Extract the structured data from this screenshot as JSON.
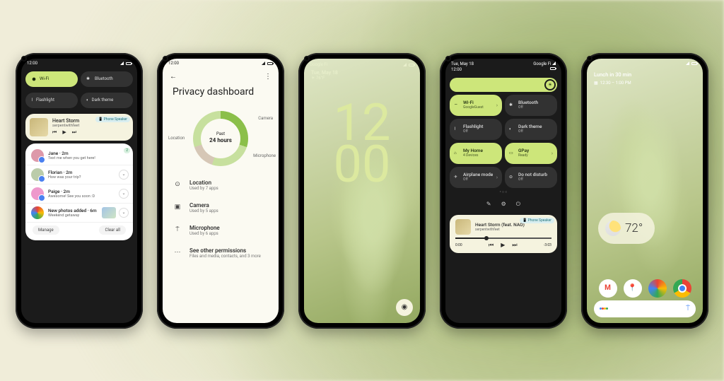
{
  "colors": {
    "accent": "#cde67a",
    "bg_dark": "#1b1b1b",
    "bg_light": "#fbfaf2",
    "tile_on": "#cde67a",
    "tile_off": "#323232"
  },
  "phone1": {
    "time": "12:00",
    "qs": [
      {
        "label": "Wi-Fi",
        "on": true
      },
      {
        "label": "Bluetooth",
        "on": false
      },
      {
        "label": "Flashlight",
        "on": false
      },
      {
        "label": "Dark theme",
        "on": false
      }
    ],
    "media": {
      "title": "Heart Storm",
      "artist": "serpentwithfeet",
      "output": "Phone Speaker"
    },
    "notifications": [
      {
        "name": "Jane",
        "time": "2m",
        "text": "Text me when you get here!",
        "badge": "2"
      },
      {
        "name": "Florian",
        "time": "2m",
        "text": "How was your trip?"
      },
      {
        "name": "Paige",
        "time": "2m",
        "text": "Awesome! See you soon :D"
      },
      {
        "name": "New photos added",
        "time": "6m",
        "text": "Weekend getaway",
        "thumb": true
      }
    ],
    "footer": {
      "manage": "Manage",
      "clear": "Clear all"
    }
  },
  "phone2": {
    "time": "12:00",
    "title": "Privacy dashboard",
    "donut": {
      "center_top": "Past",
      "center_bottom": "24 hours",
      "labels": {
        "camera": "Camera",
        "microphone": "Microphone",
        "location": "Location"
      }
    },
    "items": [
      {
        "icon": "location",
        "title": "Location",
        "sub": "Used by 7 apps"
      },
      {
        "icon": "camera",
        "title": "Camera",
        "sub": "Used by 5 apps"
      },
      {
        "icon": "mic",
        "title": "Microphone",
        "sub": "Used by 6 apps"
      },
      {
        "icon": "more",
        "title": "See other permissions",
        "sub": "Files and media, contacts, and 3 more"
      }
    ]
  },
  "phone3": {
    "carrier": "Google Fi",
    "date": "Tue, May 18",
    "temp": "76°F",
    "weather_icon": "sunny",
    "clock_top": "12",
    "clock_bottom": "00"
  },
  "phone4": {
    "date": "Tue, May 18",
    "carrier": "Google Fi",
    "time": "12:00",
    "tiles": [
      {
        "label": "Wi-Fi",
        "sub": "GoogleGuest",
        "on": true,
        "chev": true
      },
      {
        "label": "Bluetooth",
        "sub": "Off",
        "on": false
      },
      {
        "label": "Flashlight",
        "sub": "Off",
        "on": false
      },
      {
        "label": "Dark theme",
        "sub": "Off",
        "on": false
      },
      {
        "label": "My Home",
        "sub": "4 Devices",
        "on": true
      },
      {
        "label": "GPay",
        "sub": "Ready",
        "on": true,
        "chev": true
      },
      {
        "label": "Airplane mode",
        "sub": "Off",
        "on": false,
        "chev": true
      },
      {
        "label": "Do not disturb",
        "sub": "Off",
        "on": false
      }
    ],
    "media": {
      "title": "Heart Storm (feat. NAO)",
      "artist": "serpentwithfeet",
      "output": "Phone Speaker",
      "cur": "0:00",
      "dur": "-3:03"
    }
  },
  "phone5": {
    "glance_title": "Lunch in 30 min",
    "glance_sub": "12:30 – 1:00 PM",
    "temp": "72°",
    "dock": [
      "Gmail",
      "Maps",
      "Photos",
      "Chrome"
    ]
  }
}
